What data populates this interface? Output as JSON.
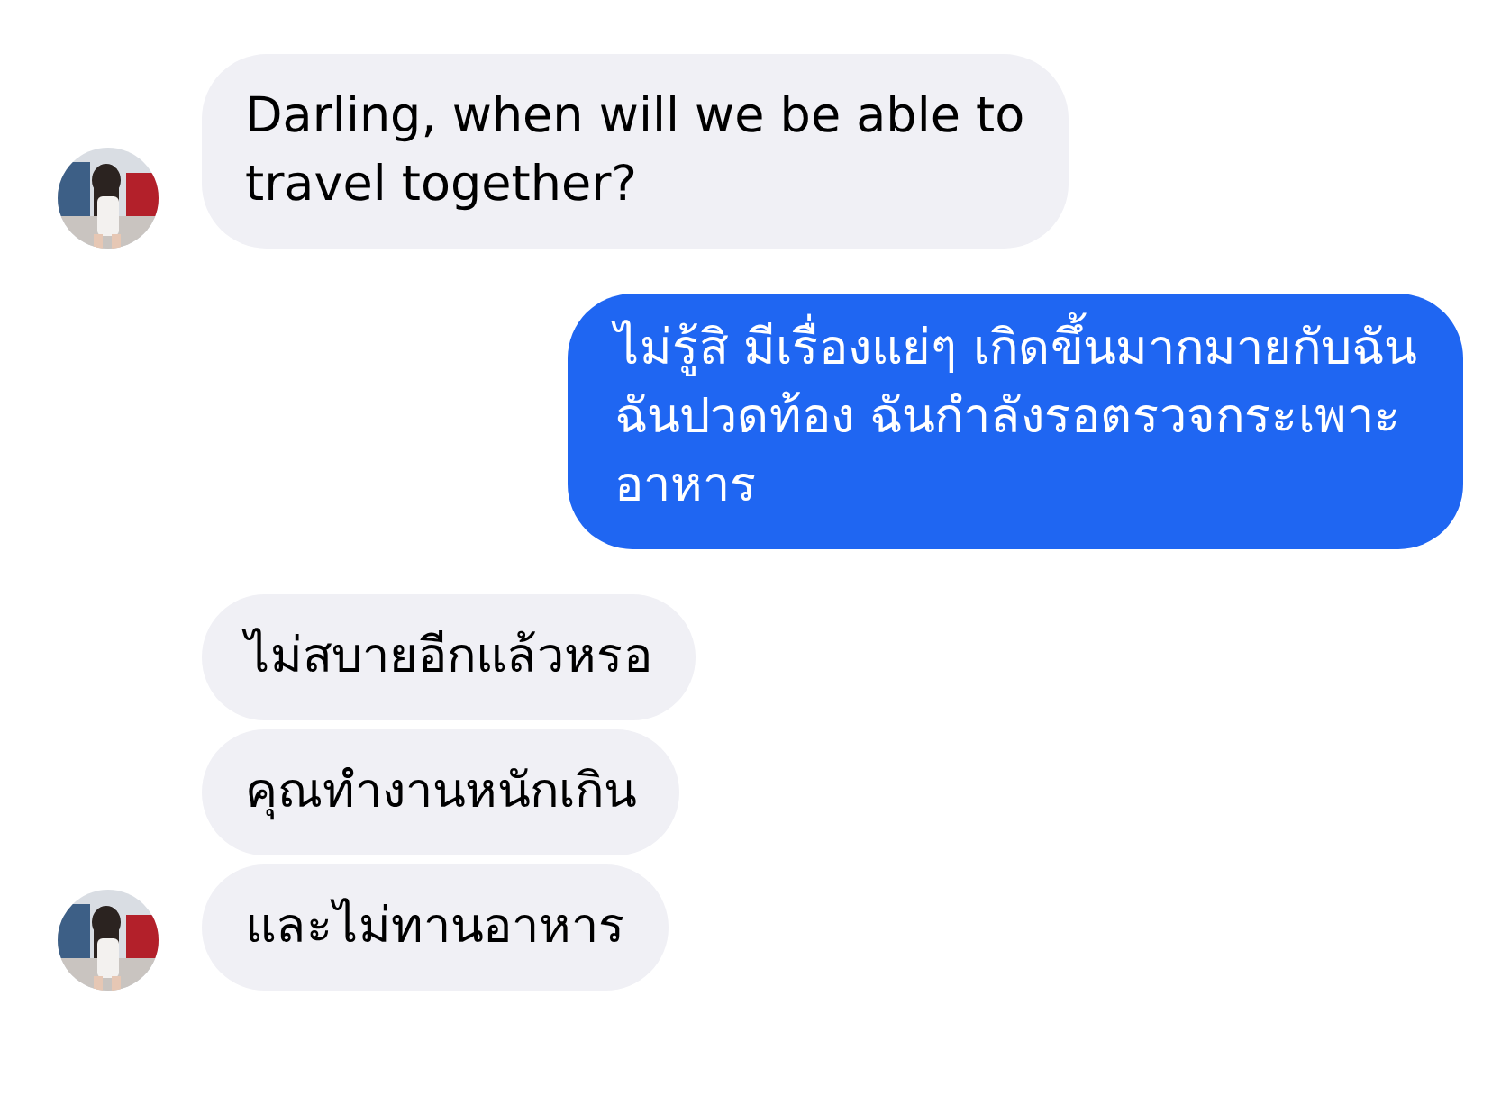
{
  "messages": [
    {
      "kind": "incoming",
      "avatar": true,
      "lines": [
        "Darling, when will we be able to",
        "travel together?"
      ]
    },
    {
      "kind": "outgoing",
      "avatar": false,
      "lines": [
        "ไม่รู้สิ มีเรื่องแย่ๆ เกิดขึ้นมากมายกับฉัน",
        "ฉันปวดท้อง ฉันกำลังรอตรวจกระเพาะ",
        "อาหาร"
      ]
    },
    {
      "kind": "incoming",
      "avatar": false,
      "lines": [
        "ไม่สบายอีกแล้วหรอ"
      ]
    },
    {
      "kind": "incoming",
      "avatar": false,
      "lines": [
        "คุณทำงานหนักเกิน"
      ]
    },
    {
      "kind": "incoming",
      "avatar": true,
      "lines": [
        "และไม่ทานอาหาร"
      ]
    }
  ]
}
